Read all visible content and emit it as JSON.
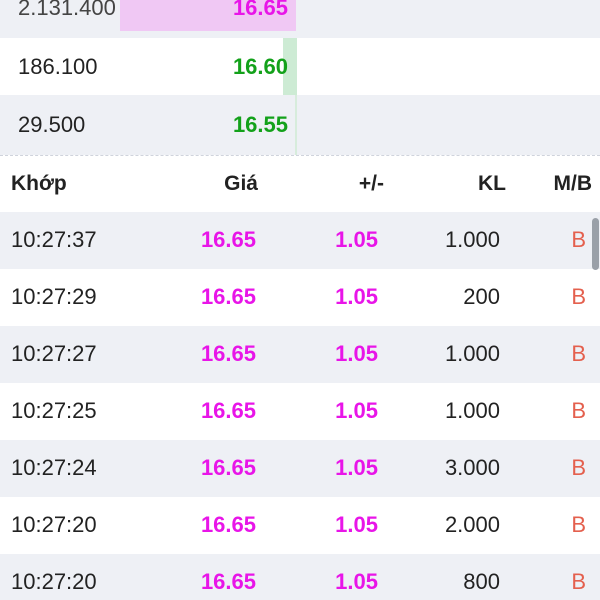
{
  "colors": {
    "ceiling": "#e815e8",
    "up": "#13a11a",
    "buy": "#e4604e",
    "row_alt": "#eef0f5",
    "bar_pink": "#f0c8f4",
    "bar_green": "#cdebd4"
  },
  "order_book": [
    {
      "volume": "2.131.400",
      "price": "16.65"
    },
    {
      "volume": "186.100",
      "price": "16.60"
    },
    {
      "volume": "29.500",
      "price": "16.55"
    }
  ],
  "trades": {
    "headers": {
      "time": "Khớp",
      "price": "Giá",
      "change": "+/-",
      "volume": "KL",
      "side": "M/B"
    },
    "rows": [
      {
        "time": "10:27:37",
        "price": "16.65",
        "change": "1.05",
        "volume": "1.000",
        "side": "B"
      },
      {
        "time": "10:27:29",
        "price": "16.65",
        "change": "1.05",
        "volume": "200",
        "side": "B"
      },
      {
        "time": "10:27:27",
        "price": "16.65",
        "change": "1.05",
        "volume": "1.000",
        "side": "B"
      },
      {
        "time": "10:27:25",
        "price": "16.65",
        "change": "1.05",
        "volume": "1.000",
        "side": "B"
      },
      {
        "time": "10:27:24",
        "price": "16.65",
        "change": "1.05",
        "volume": "3.000",
        "side": "B"
      },
      {
        "time": "10:27:20",
        "price": "16.65",
        "change": "1.05",
        "volume": "2.000",
        "side": "B"
      },
      {
        "time": "10:27:20",
        "price": "16.65",
        "change": "1.05",
        "volume": "800",
        "side": "B"
      }
    ]
  }
}
